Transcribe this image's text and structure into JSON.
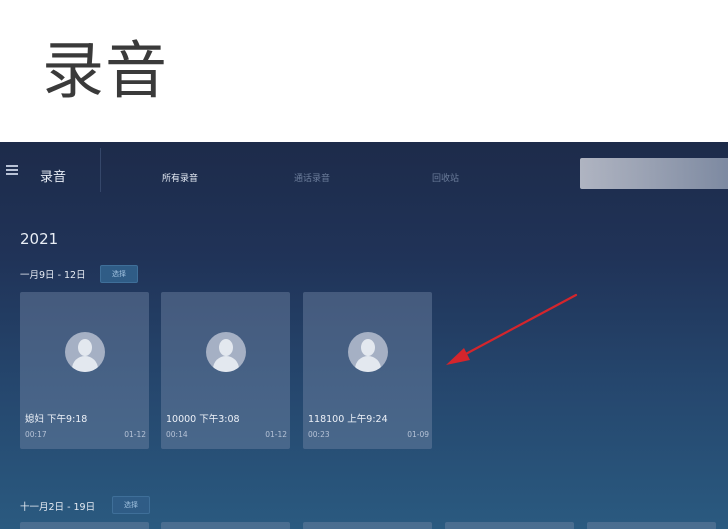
{
  "page_heading": "录音",
  "app": {
    "title": "录音",
    "menu_icon": "hamburger-menu-icon"
  },
  "tabs": [
    {
      "label": "所有录音",
      "active": true
    },
    {
      "label": "通话录音",
      "active": false
    },
    {
      "label": "回收站",
      "active": false
    }
  ],
  "year": "2021",
  "groups": [
    {
      "label": "一月9日 - 12日",
      "select_label": "选择",
      "recordings": [
        {
          "name": "媳妇 下午9:18",
          "duration": "00:17",
          "date": "01-12"
        },
        {
          "name": "10000 下午3:08",
          "duration": "00:14",
          "date": "01-12"
        },
        {
          "name": "118100 上午9:24",
          "duration": "00:23",
          "date": "01-09"
        }
      ]
    },
    {
      "label": "十一月2日 - 19日",
      "select_label": "选择"
    }
  ],
  "colors": {
    "annotation_arrow": "#d4252c",
    "background_top": "#1d2b4a",
    "background_bottom": "#2a5a80"
  }
}
